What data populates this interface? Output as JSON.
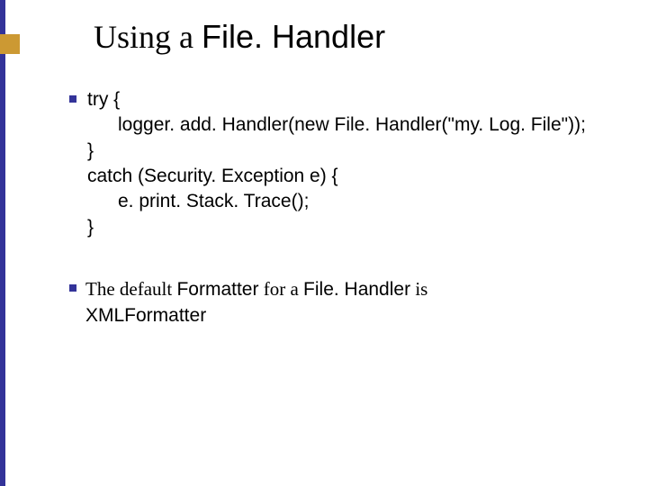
{
  "title": {
    "part1": "Using a ",
    "part2": "File. Handler"
  },
  "code": {
    "l1": "try {",
    "l2": "logger. add. Handler(new File. Handler(\"my. Log. File\"));",
    "l3": "}",
    "l4": "catch (Security. Exception e) {",
    "l5": "e. print. Stack. Trace();",
    "l6": "}"
  },
  "para": {
    "p1": "The default ",
    "p2": "Formatter",
    "p3": " for a ",
    "p4": "File. Handler",
    "p5": " is ",
    "p6": "XMLFormatter"
  }
}
